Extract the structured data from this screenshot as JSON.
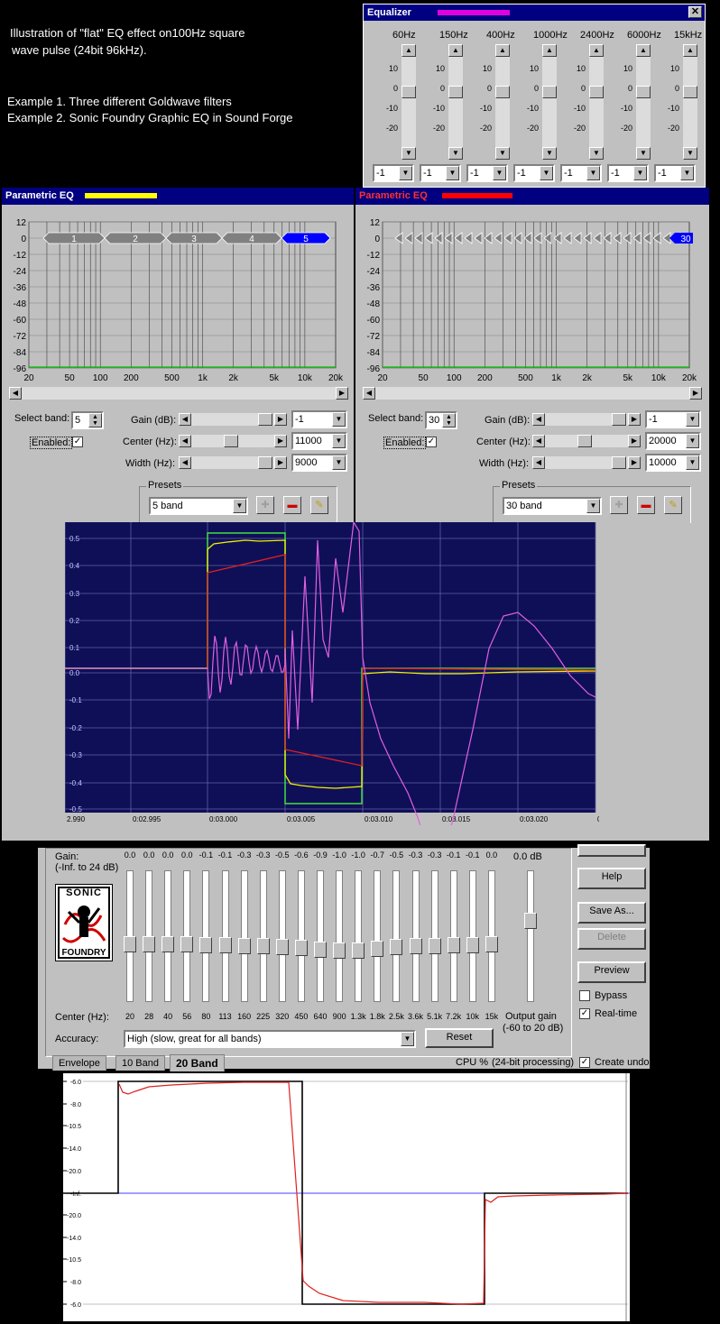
{
  "intro": {
    "line1": "Illustration of \"flat\" EQ effect on100Hz square",
    "line2": "wave pulse (24bit 96kHz).",
    "line3": "Example 1. Three different Goldwave filters",
    "line4": "Example 2. Sonic Foundry Graphic EQ in Sound Forge"
  },
  "equalizer": {
    "title": "Equalizer",
    "accent": "#e000e0",
    "bands": [
      {
        "freq": "60Hz",
        "value": "-1"
      },
      {
        "freq": "150Hz",
        "value": "-1"
      },
      {
        "freq": "400Hz",
        "value": "-1"
      },
      {
        "freq": "1000Hz",
        "value": "-1"
      },
      {
        "freq": "2400Hz",
        "value": "-1"
      },
      {
        "freq": "6000Hz",
        "value": "-1"
      },
      {
        "freq": "15kHz",
        "value": "-1"
      }
    ],
    "scale": [
      "10",
      "0",
      "-10",
      "-20"
    ]
  },
  "peq_left": {
    "title": "Parametric EQ",
    "accent": "#ffff00",
    "yticks": [
      "12",
      "0",
      "-12",
      "-24",
      "-36",
      "-48",
      "-60",
      "-72",
      "-84",
      "-96"
    ],
    "xticks": [
      "20",
      "50",
      "100",
      "200",
      "500",
      "1k",
      "2k",
      "5k",
      "10k",
      "20k"
    ],
    "nodes": [
      "1",
      "2",
      "3",
      "4",
      "5"
    ],
    "select_band_label": "Select band:",
    "select_band": "5",
    "enabled_label": "Enabled:",
    "gain_label": "Gain (dB):",
    "gain": "-1",
    "center_label": "Center (Hz):",
    "center": "11000",
    "width_label": "Width (Hz):",
    "width": "9000",
    "presets_label": "Presets",
    "preset": "5 band"
  },
  "peq_right": {
    "title": "Parametric EQ",
    "accent": "#ff0000",
    "selected_node": "30",
    "select_band_label": "Select band:",
    "select_band": "30",
    "enabled_label": "Enabled:",
    "gain_label": "Gain (dB):",
    "gain": "-1",
    "center_label": "Center (Hz):",
    "center": "20000",
    "width_label": "Width (Hz):",
    "width": "10000",
    "presets_label": "Presets",
    "preset": "30 band"
  },
  "waveform": {
    "yticks": [
      "0.5",
      "0.4",
      "0.3",
      "0.2",
      "0.1",
      "0.0",
      "-0.1",
      "-0.2",
      "-0.3",
      "-0.4",
      "-0.5"
    ],
    "xticks": [
      "2.990",
      "0:02.995",
      "0:03.000",
      "0:03.005",
      "0:03.010",
      "0:03.015",
      "0:03.020",
      "0"
    ]
  },
  "sonic": {
    "gain_label_1": "Gain:",
    "gain_label_2": "(-Inf. to 24 dB)",
    "gains": [
      "0.0",
      "0.0",
      "0.0",
      "0.0",
      "-0.1",
      "-0.1",
      "-0.3",
      "-0.3",
      "-0.5",
      "-0.6",
      "-0.9",
      "-1.0",
      "-1.0",
      "-0.7",
      "-0.5",
      "-0.3",
      "-0.3",
      "-0.1",
      "-0.1",
      "0.0"
    ],
    "centers": [
      "20",
      "28",
      "40",
      "56",
      "80",
      "113",
      "160",
      "225",
      "320",
      "450",
      "640",
      "900",
      "1.3k",
      "1.8k",
      "2.5k",
      "3.6k",
      "5.1k",
      "7.2k",
      "10k",
      "15k"
    ],
    "output_gain_value": "0.0 dB",
    "center_label": "Center (Hz):",
    "output_gain_label_1": "Output gain",
    "output_gain_label_2": "(-60 to 20 dB)",
    "accuracy_label": "Accuracy:",
    "accuracy_value": "High (slow, great for all bands)",
    "reset": "Reset",
    "help": "Help",
    "save_as": "Save As...",
    "delete": "Delete",
    "preview": "Preview",
    "bypass": "Bypass",
    "realtime": "Real-time",
    "create_undo": "Create undo",
    "cpu": "CPU %",
    "processing": "(24-bit processing)",
    "tabs": [
      "Envelope",
      "10 Band",
      "20 Band"
    ],
    "logo_top": "SONIC",
    "logo_bottom": "FOUNDRY"
  },
  "bottom_plot": {
    "yticks": [
      "-6.0",
      "-8.0",
      "-10.5",
      "-14.0",
      "-20.0",
      "-Inf.",
      "-20.0",
      "-14.0",
      "-10.5",
      "-8.0",
      "-6.0"
    ]
  }
}
